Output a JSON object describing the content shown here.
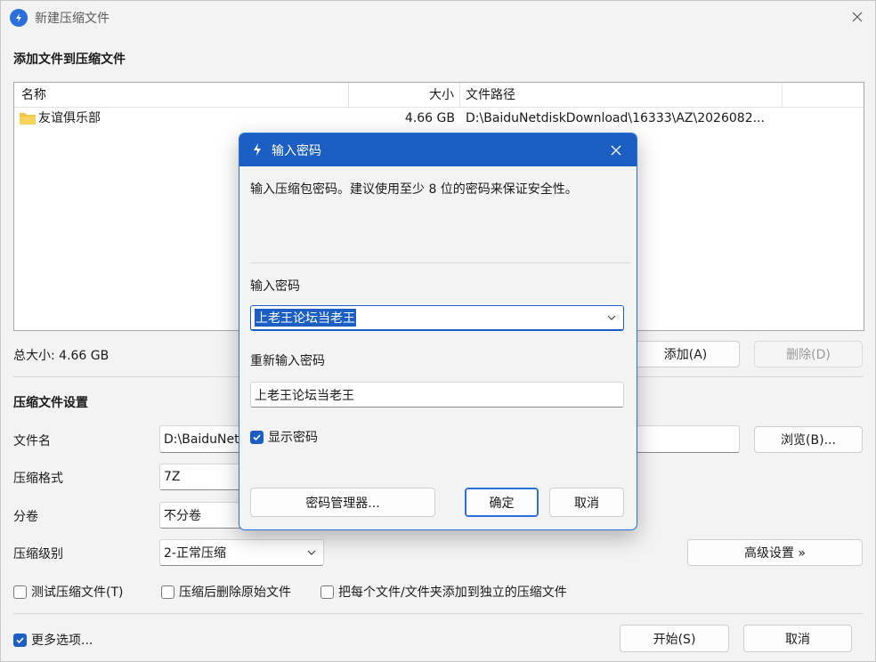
{
  "window": {
    "title": "新建压缩文件",
    "accent": "#1c5fc4"
  },
  "add_section": {
    "title": "添加文件到压缩文件",
    "columns": {
      "name": "名称",
      "size": "大小",
      "path": "文件路径"
    },
    "rows": [
      {
        "name": "友谊俱乐部",
        "size": "4.66 GB",
        "path": "D:\\BaiduNetdiskDownload\\16333\\AZ\\2026082..."
      }
    ],
    "total": "总大小: 4.66 GB",
    "add_label": "添加(A)",
    "delete_label": "删除(D)"
  },
  "settings": {
    "title": "压缩文件设置",
    "filename_label": "文件名",
    "filename_value": "D:\\BaiduNet",
    "browse_label": "浏览(B)...",
    "format_label": "压缩格式",
    "format_value": "7Z",
    "split_label": "分卷",
    "split_value": "不分卷",
    "level_label": "压缩级别",
    "level_value": "2-正常压缩",
    "advanced_label": "高级设置 »",
    "test_label": "测试压缩文件(T)",
    "delete_after_label": "压缩后删除原始文件",
    "separate_label": "把每个文件/文件夹添加到独立的压缩文件"
  },
  "footer": {
    "more_options_label": "更多选项...",
    "start_label": "开始(S)",
    "cancel_label": "取消"
  },
  "dialog": {
    "title": "输入密码",
    "hint": "输入压缩包密码。建议使用至少 8 位的密码来保证安全性。",
    "password_label": "输入密码",
    "password_value": "上老王论坛当老王",
    "confirm_label": "重新输入密码",
    "confirm_value": "上老王论坛当老王",
    "show_password_label": "显示密码",
    "manager_label": "密码管理器...",
    "ok_label": "确定",
    "cancel_label": "取消"
  }
}
